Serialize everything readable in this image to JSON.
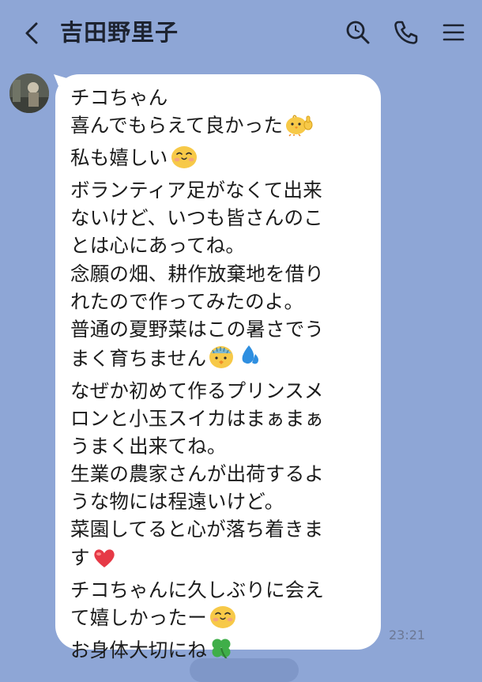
{
  "header": {
    "title": "吉田野里子",
    "icons": [
      "chevron-left-icon",
      "search-icon",
      "phone-icon",
      "menu-icon"
    ]
  },
  "message": {
    "lines": [
      {
        "text": "チコちゃん",
        "emoji": null
      },
      {
        "text": "喜んでもらえて良かった",
        "emoji": "chick-thumbs-up-emoji"
      },
      {
        "text": "私も嬉しい",
        "emoji": "happy-face-emoji"
      },
      {
        "text": "ボランティア足がなくて出来",
        "emoji": null
      },
      {
        "text": "ないけど、いつも皆さんのこ",
        "emoji": null
      },
      {
        "text": "とは心にあってね。",
        "emoji": null
      },
      {
        "text": "念願の畑、耕作放棄地を借り",
        "emoji": null
      },
      {
        "text": "れたので作ってみたのよ。",
        "emoji": null
      },
      {
        "text": "普通の夏野菜はこの暑さでう",
        "emoji": null
      },
      {
        "text": "まく育ちません",
        "emoji": "sweating-face-emoji"
      },
      {
        "text": "なぜか初めて作るプリンスメ",
        "emoji": null
      },
      {
        "text": "ロンと小玉スイカはまぁまぁ",
        "emoji": null
      },
      {
        "text": "うまく出来てね。",
        "emoji": null
      },
      {
        "text": "生業の農家さんが出荷するよ",
        "emoji": null
      },
      {
        "text": "うな物には程遠いけど。",
        "emoji": null
      },
      {
        "text": "菜園してると心が落ち着きま",
        "emoji": null
      },
      {
        "text": "す",
        "emoji": "red-heart-emoji"
      },
      {
        "text": "チコちゃんに久しぶりに会え",
        "emoji": null
      },
      {
        "text": "て嬉しかったー",
        "emoji": "happy-face-emoji"
      },
      {
        "text": "お身体大切にね",
        "emoji": "four-leaf-clover-emoji"
      }
    ],
    "time": "23:21"
  },
  "colors": {
    "background": "#8ea6d6",
    "bubble": "#ffffff",
    "text": "#1b1b1b",
    "emoji_yellow": "#f7c948",
    "heart": "#e63946",
    "clover": "#3fae49",
    "sweat_drop": "#2f8fe0"
  }
}
